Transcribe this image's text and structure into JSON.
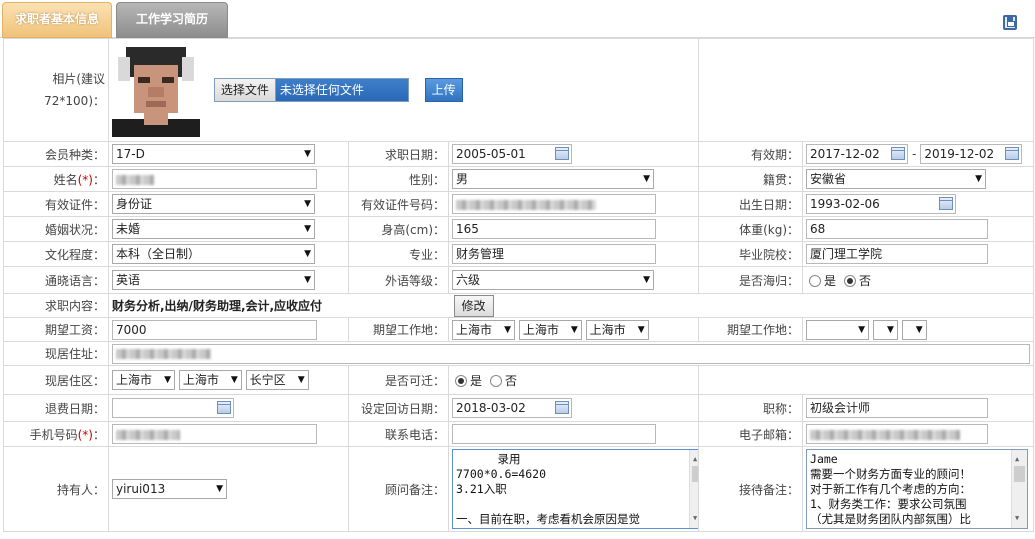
{
  "tabs": {
    "basic": "求职者基本信息",
    "resume": "工作学习简历"
  },
  "photo": {
    "label": "相片(建议72*100)：",
    "file_button": "选择文件",
    "file_status": "未选择任何文件",
    "upload_button": "上传"
  },
  "fields": {
    "member_type": {
      "label": "会员种类：",
      "value": "17-D"
    },
    "apply_date": {
      "label": "求职日期：",
      "value": "2005-05-01"
    },
    "validity": {
      "label": "有效期：",
      "from": "2017-12-02",
      "sep": "-",
      "to": "2019-12-02"
    },
    "name": {
      "label": "姓名",
      "req": "(*)",
      "colon": "："
    },
    "gender": {
      "label": "性别：",
      "value": "男"
    },
    "native_place": {
      "label": "籍贯：",
      "value": "安徽省"
    },
    "id_type": {
      "label": "有效证件：",
      "value": "身份证"
    },
    "id_number": {
      "label": "有效证件号码："
    },
    "birth_date": {
      "label": "出生日期：",
      "value": "1993-02-06"
    },
    "marital": {
      "label": "婚姻状况：",
      "value": "未婚"
    },
    "height": {
      "label": "身高(cm)：",
      "value": "165"
    },
    "weight": {
      "label": "体重(kg)：",
      "value": "68"
    },
    "education": {
      "label": "文化程度：",
      "value": "本科（全日制）"
    },
    "major": {
      "label": "专业：",
      "value": "财务管理"
    },
    "school": {
      "label": "毕业院校：",
      "value": "厦门理工学院"
    },
    "language": {
      "label": "通晓语言：",
      "value": "英语"
    },
    "foreign_level": {
      "label": "外语等级：",
      "value": "六级"
    },
    "returnee": {
      "label": "是否海归：",
      "yes": "是",
      "no": "否",
      "selected": "否"
    },
    "job_content": {
      "label": "求职内容：",
      "value": "财务分析,出纳/财务助理,会计,应收应付",
      "button": "修改"
    },
    "salary": {
      "label": "期望工资：",
      "value": "7000"
    },
    "work_place1": {
      "label": "期望工作地：",
      "values": [
        "上海市",
        "上海市",
        "上海市"
      ]
    },
    "work_place2": {
      "label": "期望工作地：",
      "values": [
        "",
        "",
        ""
      ]
    },
    "address": {
      "label": "现居住址："
    },
    "district": {
      "label": "现居住区：",
      "values": [
        "上海市",
        "上海市",
        "长宁区"
      ]
    },
    "relocate": {
      "label": "是否可迁：",
      "yes": "是",
      "no": "否",
      "selected": "是"
    },
    "refund_date": {
      "label": "退费日期：",
      "value": ""
    },
    "revisit_date": {
      "label": "设定回访日期：",
      "value": "2018-03-02"
    },
    "title": {
      "label": "职称：",
      "value": "初级会计师"
    },
    "mobile": {
      "label": "手机号码",
      "req": "(*)",
      "colon": "："
    },
    "phone": {
      "label": "联系电话："
    },
    "email": {
      "label": "电子邮箱："
    },
    "holder": {
      "label": "持有人：",
      "value": "yirui013"
    },
    "consultant_note": {
      "label": "顾问备注：",
      "text": "      录用\n7700*0.6=4620\n3.21入职\n\n一、目前在职，考虑看机会原因是觉"
    },
    "reception_note": {
      "label": "接待备注：",
      "text": "Jame\n需要一个财务方面专业的顾问！\n对于新工作有几个考虑的方向：\n1、财务类工作：要求公司氛围\n（尤其是财务团队内部氛围）比"
    }
  }
}
